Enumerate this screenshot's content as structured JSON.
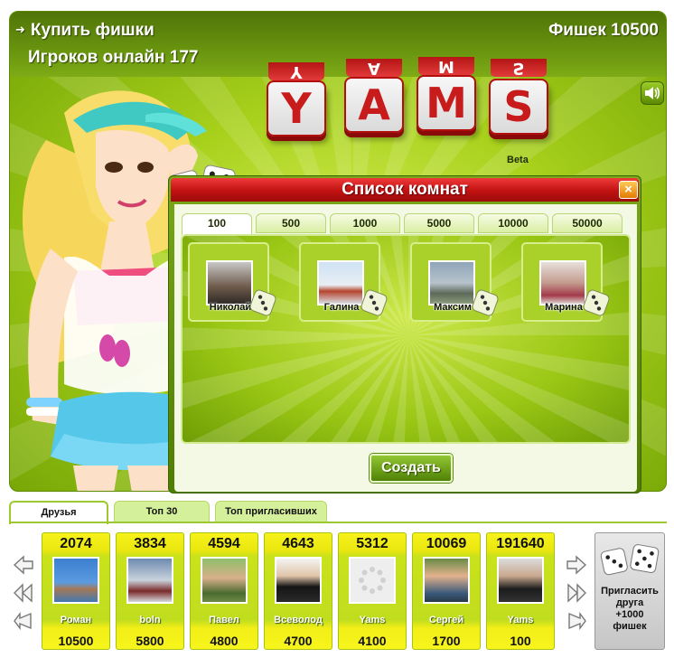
{
  "hud": {
    "buy_chips": "Купить фишки",
    "online_label": "Игроков онлайн 177",
    "chips_label": "Фишек 10500"
  },
  "logo": {
    "letters": [
      "Y",
      "A",
      "M",
      "S"
    ],
    "beta": "Beta"
  },
  "dialog": {
    "title": "Список комнат",
    "close": "×",
    "tabs": [
      "100",
      "500",
      "1000",
      "5000",
      "10000",
      "50000"
    ],
    "active_tab": "100",
    "rooms": [
      {
        "name": "Николай"
      },
      {
        "name": "Галина"
      },
      {
        "name": "Максим"
      },
      {
        "name": "Марина"
      }
    ],
    "create_button": "Создать"
  },
  "friends": {
    "tabs": [
      "Друзья",
      "Топ 30",
      "Топ пригласивших"
    ],
    "active_tab": "Друзья",
    "cards": [
      {
        "score": "2074",
        "name": "Роман",
        "chips": "10500"
      },
      {
        "score": "3834",
        "name": "boln",
        "chips": "5800"
      },
      {
        "score": "4594",
        "name": "Павел",
        "chips": "4800"
      },
      {
        "score": "4643",
        "name": "Всеволод",
        "chips": "4700"
      },
      {
        "score": "5312",
        "name": "Yams",
        "chips": "4100"
      },
      {
        "score": "10069",
        "name": "Сергей",
        "chips": "1700"
      },
      {
        "score": "191640",
        "name": "Yams",
        "chips": "100"
      }
    ],
    "invite": {
      "line1": "Пригласить",
      "line2": "друга",
      "line3": "+1000",
      "line4": "фишек"
    }
  },
  "colors": {
    "accent_green": "#8fc021",
    "header_red": "#c11111",
    "card_yellow": "#f6f21a"
  }
}
